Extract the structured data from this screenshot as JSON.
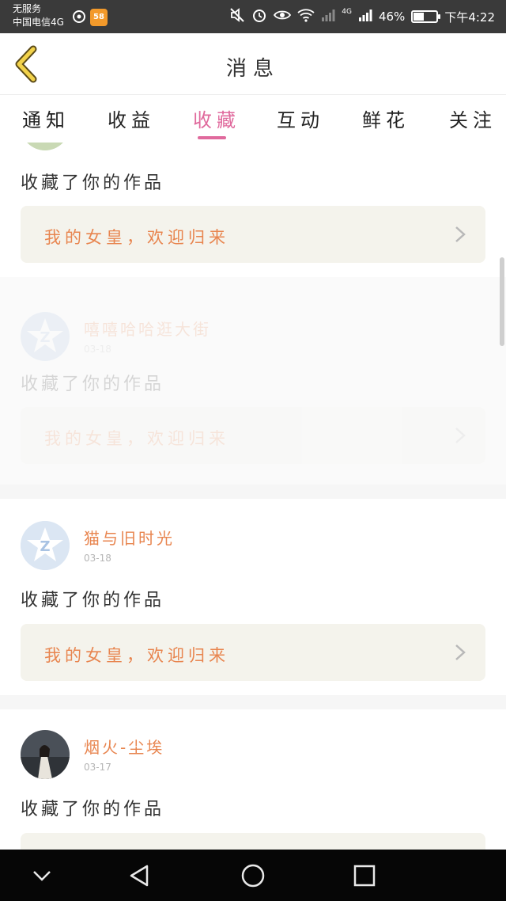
{
  "status_bar": {
    "carrier_line1": "无服务",
    "carrier_line2": "中国电信4G",
    "app_badge": "58",
    "network": "4G",
    "battery_text": "46%",
    "battery_level": 0.46,
    "time": "下午4:22"
  },
  "header": {
    "title": "消息"
  },
  "tabs": [
    {
      "label": "通知"
    },
    {
      "label": "收益"
    },
    {
      "label": "收藏"
    },
    {
      "label": "互动"
    },
    {
      "label": "鲜花"
    },
    {
      "label": "关注"
    }
  ],
  "active_tab": "收藏",
  "messages": [
    {
      "action": "收藏了你的作品",
      "work_title": "我的女皇，欢迎归来"
    },
    {
      "username": "嘻嘻哈哈逛大街",
      "date": "03-18",
      "action": "收藏了你的作品",
      "work_title": "我的女皇，欢迎归来"
    },
    {
      "username": "猫与旧时光",
      "date": "03-18",
      "action": "收藏了你的作品",
      "work_title": "我的女皇，欢迎归来"
    },
    {
      "username": "烟火-尘埃",
      "date": "03-17",
      "action": "收藏了你的作品"
    }
  ],
  "colors": {
    "accent_pink": "#e06a9d",
    "username_orange": "#e8854f",
    "back_arrow_yellow": "#f2d24a",
    "work_box_bg": "#f4f3ec"
  },
  "icons": {
    "back": "chevron-left-icon",
    "work_arrow": "chevron-right-icon",
    "nav_back": "triangle-back-icon",
    "nav_home": "circle-home-icon",
    "nav_recent": "square-recent-icon",
    "nav_hide": "chevron-down-icon"
  }
}
